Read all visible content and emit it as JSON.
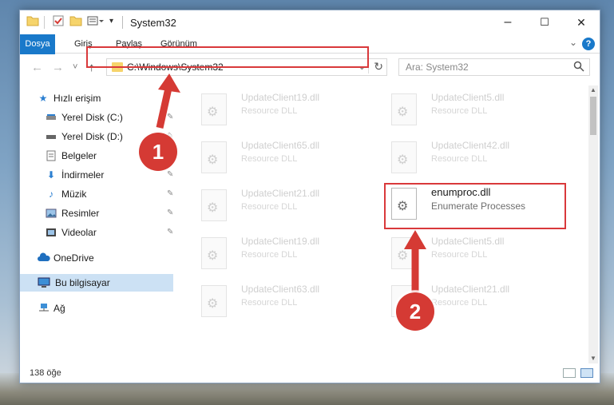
{
  "window": {
    "title": "System32",
    "minimize": "–",
    "maximize": "☐",
    "close": "✕"
  },
  "ribbon": {
    "tabs": [
      "Dosya",
      "Giriş",
      "Paylaş",
      "Görünüm"
    ],
    "help": "?"
  },
  "nav": {
    "back": "←",
    "forward": "→",
    "recent": "˅",
    "up": "↑",
    "address": "C:\\Windows\\System32",
    "search_placeholder": "Ara: System32"
  },
  "sidebar": {
    "items": [
      {
        "label": "Hızlı erişim",
        "icon": "star-icon"
      },
      {
        "label": "Yerel Disk (C:)",
        "icon": "drive-icon"
      },
      {
        "label": "Yerel Disk (D:)",
        "icon": "drive-icon"
      },
      {
        "label": "Belgeler",
        "icon": "documents-icon"
      },
      {
        "label": "İndirmeler",
        "icon": "download-icon"
      },
      {
        "label": "Müzik",
        "icon": "music-icon"
      },
      {
        "label": "Resimler",
        "icon": "pictures-icon"
      },
      {
        "label": "Videolar",
        "icon": "video-icon"
      },
      {
        "label": "OneDrive",
        "icon": "cloud-icon"
      },
      {
        "label": "Bu bilgisayar",
        "icon": "computer-icon"
      },
      {
        "label": "Ağ",
        "icon": "network-icon"
      }
    ]
  },
  "files": [
    {
      "name": "UpdateClient19.dll",
      "desc": "Resource DLL"
    },
    {
      "name": "UpdateClient5.dll",
      "desc": "Resource DLL"
    },
    {
      "name": "UpdateClient65.dll",
      "desc": "Resource DLL"
    },
    {
      "name": "UpdateClient42.dll",
      "desc": "Resource DLL"
    },
    {
      "name": "UpdateClient21.dll",
      "desc": "Resource DLL"
    },
    {
      "name": "enumproc.dll",
      "desc": "Enumerate Processes"
    },
    {
      "name": "UpdateClient19.dll",
      "desc": "Resource DLL"
    },
    {
      "name": "UpdateClient5.dll",
      "desc": "Resource DLL"
    },
    {
      "name": "UpdateClient63.dll",
      "desc": "Resource DLL"
    },
    {
      "name": "UpdateClient21.dll",
      "desc": "Resource DLL"
    }
  ],
  "status": {
    "item_count": "138 öğe"
  },
  "annotations": {
    "step1": "1",
    "step2": "2",
    "color": "#d9393b"
  }
}
